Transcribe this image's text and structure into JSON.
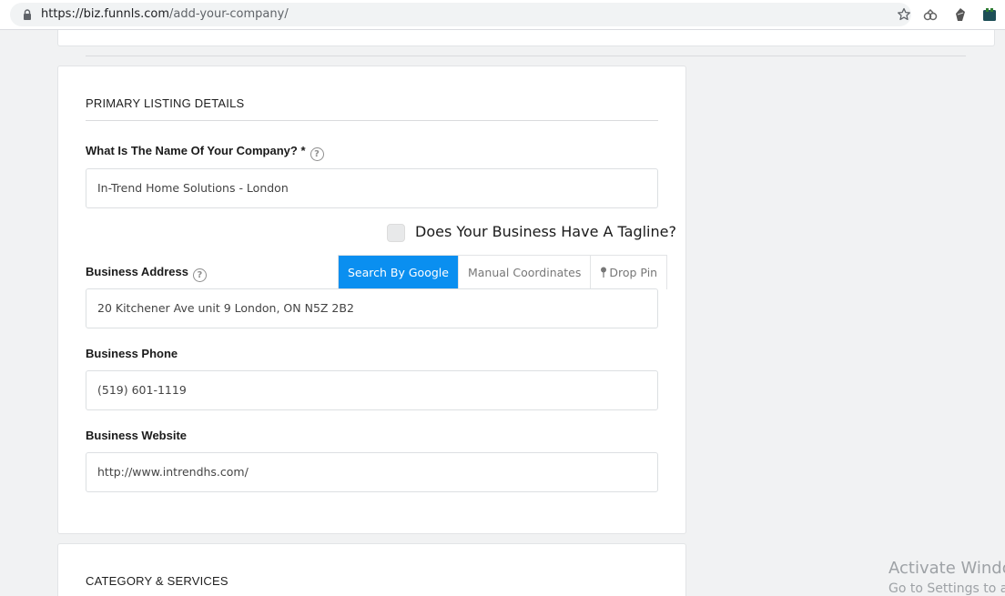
{
  "browser": {
    "url_host": "https://biz.funnls.com",
    "url_path": "/add-your-company/"
  },
  "form": {
    "section_title": "PRIMARY LISTING DETAILS",
    "company_name": {
      "label": "What Is The Name Of Your Company? *",
      "value": "In-Trend Home Solutions - London"
    },
    "tagline": {
      "label": "Does Your Business Have A Tagline?",
      "checked": false
    },
    "address": {
      "label": "Business Address",
      "tabs": [
        "Search By Google",
        "Manual Coordinates",
        "Drop Pin"
      ],
      "active_tab": "Search By Google",
      "value": "20 Kitchener Ave unit 9 London, ON N5Z 2B2"
    },
    "phone": {
      "label": "Business Phone",
      "value": "(519) 601-1119"
    },
    "website": {
      "label": "Business Website",
      "value": "http://www.intrendhs.com/"
    },
    "help_glyph": "?"
  },
  "next_section": {
    "title": "CATEGORY & SERVICES"
  },
  "watermark": {
    "line1": "Activate Windo",
    "line2": "Go to Settings to ac"
  },
  "colors": {
    "accent": "#0a8ff0"
  }
}
